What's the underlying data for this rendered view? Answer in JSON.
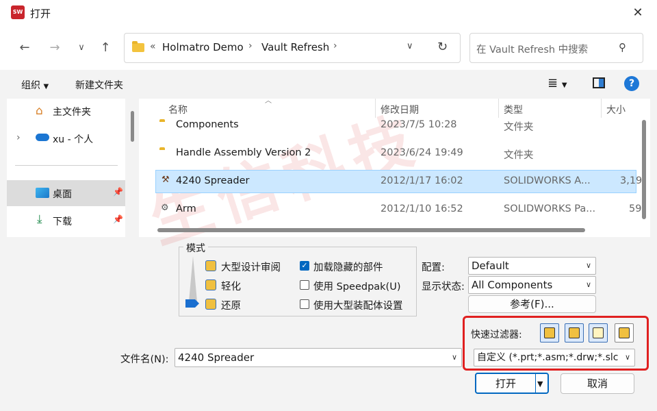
{
  "window": {
    "title": "打开",
    "logo_text": "SW 2023"
  },
  "nav": {
    "breadcrumb": [
      "Holmatro Demo",
      "Vault Refresh"
    ],
    "search_placeholder": "在 Vault Refresh 中搜索"
  },
  "toolbar": {
    "organize": "组织",
    "new_folder": "新建文件夹"
  },
  "sidebar": {
    "items": [
      {
        "label": "主文件夹",
        "icon": "home-icon"
      },
      {
        "label": "xu - 个人",
        "icon": "cloud-icon"
      },
      {
        "label": "桌面",
        "icon": "desktop-icon"
      },
      {
        "label": "下载",
        "icon": "download-icon"
      }
    ]
  },
  "filelist": {
    "columns": [
      "名称",
      "修改日期",
      "类型",
      "大小"
    ],
    "rows": [
      {
        "name": "Components",
        "date": "2023/7/5 10:28",
        "type": "文件夹",
        "size": "",
        "icon": "folder-icon"
      },
      {
        "name": "Handle Assembly Version 2",
        "date": "2023/6/24 19:49",
        "type": "文件夹",
        "size": "",
        "icon": "folder-icon"
      },
      {
        "name": "4240 Spreader",
        "date": "2012/1/17 16:02",
        "type": "SOLIDWORKS A...",
        "size": "3,19",
        "icon": "assembly-icon"
      },
      {
        "name": "Arm",
        "date": "2012/1/10 16:52",
        "type": "SOLIDWORKS Pa...",
        "size": "59",
        "icon": "part-icon"
      }
    ]
  },
  "options": {
    "mode_label": "模式",
    "modes": [
      "大型设计审阅",
      "轻化",
      "还原"
    ],
    "checks": [
      {
        "label": "加载隐藏的部件",
        "checked": true
      },
      {
        "label": "使用 Speedpak(U)",
        "checked": false
      },
      {
        "label": "使用大型装配体设置",
        "checked": false
      }
    ],
    "config_label": "配置:",
    "config_value": "Default",
    "display_label": "显示状态:",
    "display_value": "All Components",
    "reference_button": "参考(F)..."
  },
  "filter": {
    "label": "快速过滤器:",
    "type_value": "自定义 (*.prt;*.asm;*.drw;*.slc"
  },
  "filename": {
    "label": "文件名(N):",
    "value": "4240 Spreader"
  },
  "buttons": {
    "open": "打开",
    "cancel": "取消"
  },
  "watermark": "生信科技",
  "colors": {
    "accent": "#0067c0",
    "selection": "#cce8ff",
    "highlight_box": "#e02020"
  }
}
